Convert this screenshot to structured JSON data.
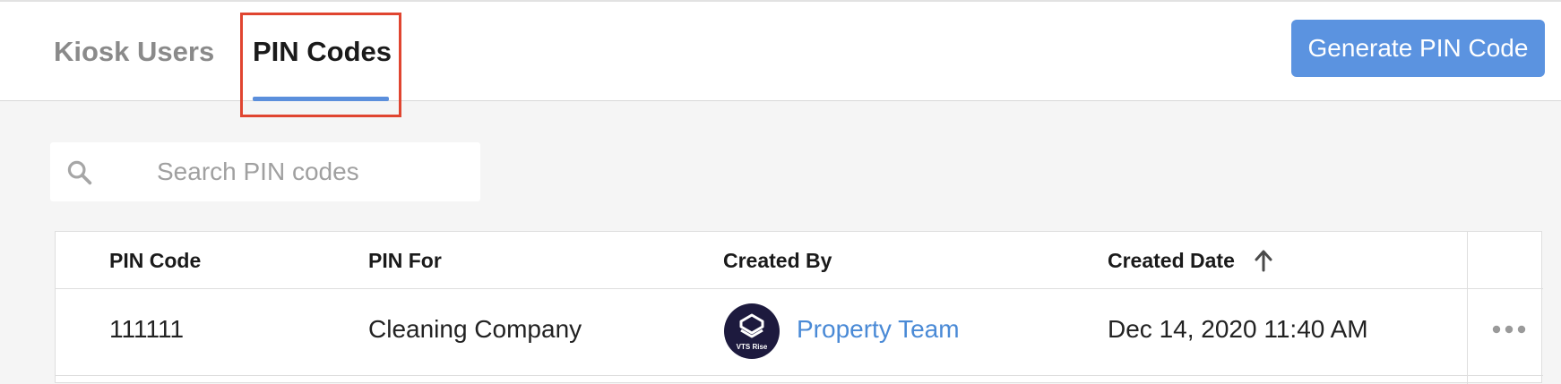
{
  "tabs": {
    "kiosk_users": "Kiosk Users",
    "pin_codes": "PIN Codes",
    "active": "pin_codes"
  },
  "actions": {
    "generate_label": "Generate PIN Code"
  },
  "search": {
    "placeholder": "Search PIN codes",
    "value": ""
  },
  "table": {
    "headers": {
      "pin_code": "PIN Code",
      "pin_for": "PIN For",
      "created_by": "Created By",
      "created_date": "Created Date"
    },
    "sort": {
      "column": "created_date",
      "direction": "ascending"
    },
    "rows": [
      {
        "pin_code": "111111",
        "pin_for": "Cleaning Company",
        "created_by": "Property Team",
        "created_by_logo_text": "VTS Rise",
        "created_date": "Dec 14, 2020 11:40 AM"
      }
    ]
  },
  "colors": {
    "accent": "#5b93e0",
    "link": "#4a8ad6",
    "highlight": "#e04530",
    "avatar_bg": "#1d1a3e"
  },
  "icons": {
    "search": "search-icon",
    "sort": "arrow-up-icon",
    "more": "more-horizontal-icon"
  }
}
